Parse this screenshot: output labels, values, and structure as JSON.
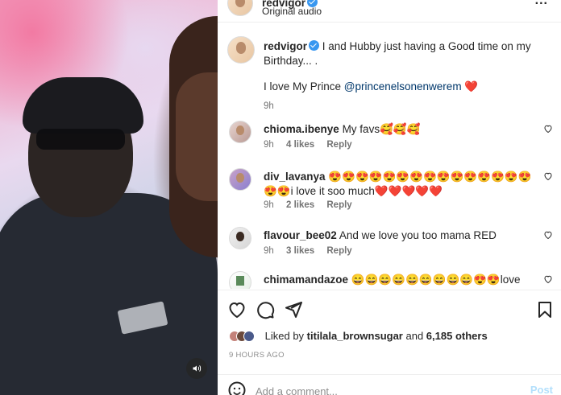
{
  "header": {
    "username": "redvigor",
    "subtitle": "Original audio",
    "more": "..."
  },
  "caption": {
    "username": "redvigor",
    "text_line1": "I and Hubby just having a Good time on my Birthday... .",
    "text_line2_prefix": "I love My Prince ",
    "mention": "@princenelsonenwerem",
    "heart": "❤️",
    "time": "9h"
  },
  "comments": [
    {
      "username": "chioma.ibenye",
      "text": "My favs🥰🥰🥰",
      "time": "9h",
      "likes": "4 likes",
      "reply": "Reply"
    },
    {
      "username": "div_lavanya",
      "text": "😍😍😍😍😍😍😍😍😍😍😍😍😍😍😍😍😍i love it soo much❤️❤️❤️❤️❤️",
      "time": "9h",
      "likes": "2 likes",
      "reply": "Reply"
    },
    {
      "username": "flavour_bee02",
      "text": "And we love you too mama RED",
      "time": "9h",
      "likes": "3 likes",
      "reply": "Reply"
    },
    {
      "username": "chimamandazoe",
      "text": "😄😄😄😄😄😄😄😄😄😍😍love",
      "time": "",
      "likes": "",
      "reply": ""
    }
  ],
  "likes": {
    "prefix": "Liked by ",
    "liker": "titilala_brownsugar",
    "middle": " and ",
    "others": "6,185 others"
  },
  "timeago": "9 HOURS AGO",
  "add_comment": {
    "placeholder": "Add a comment...",
    "post_label": "Post"
  },
  "icons": {
    "like": "heart-icon",
    "comment": "comment-icon",
    "share": "share-icon",
    "save": "bookmark-icon",
    "emoji": "emoji-icon",
    "mute": "speaker-icon"
  }
}
